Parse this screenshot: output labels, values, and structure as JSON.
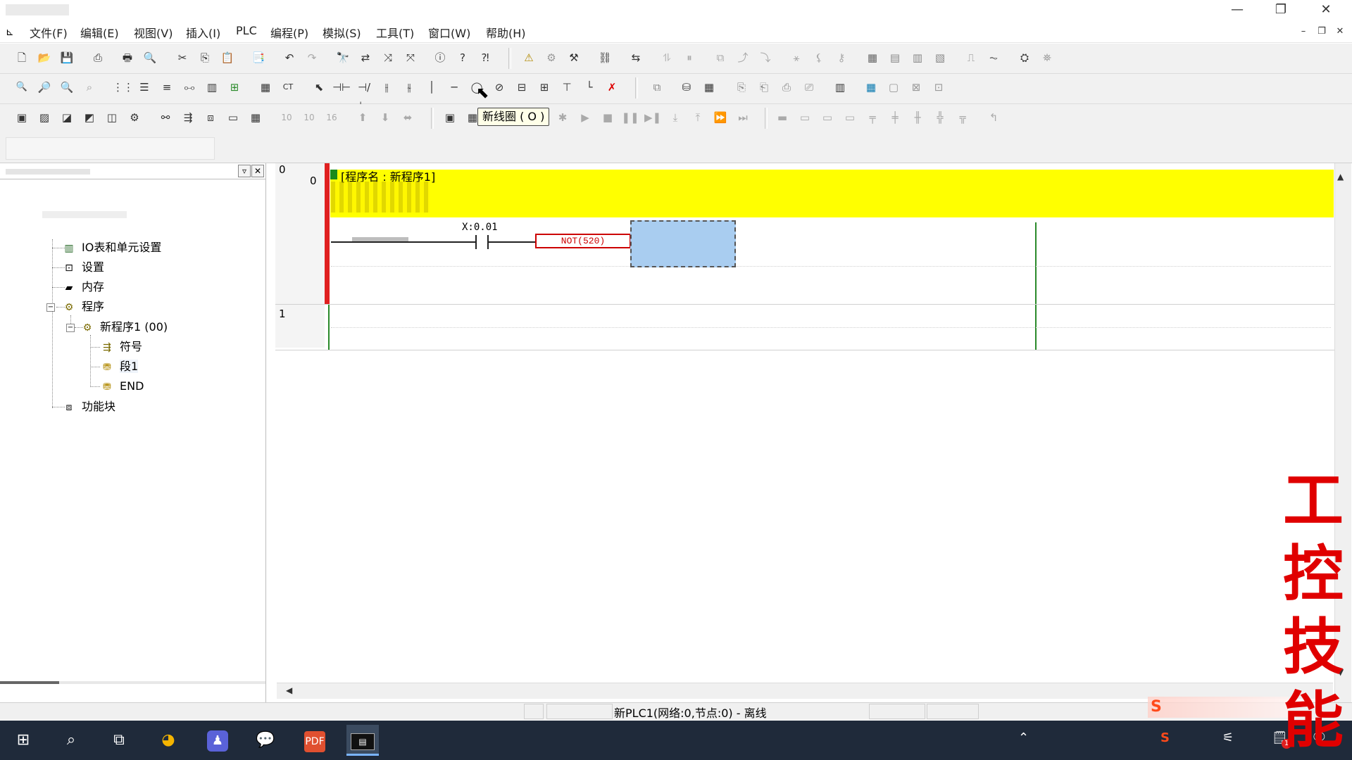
{
  "window": {
    "minimize": "—",
    "restore": "❐",
    "close": "✕"
  },
  "menu": [
    {
      "label": "文件(F)"
    },
    {
      "label": "编辑(E)"
    },
    {
      "label": "视图(V)"
    },
    {
      "label": "插入(I)"
    },
    {
      "label": "PLC"
    },
    {
      "label": "编程(P)"
    },
    {
      "label": "模拟(S)"
    },
    {
      "label": "工具(T)"
    },
    {
      "label": "窗口(W)"
    },
    {
      "label": "帮助(H)"
    }
  ],
  "tooltip": "新线圈 ( O )",
  "tree": {
    "items": [
      {
        "label": "IO表和单元设置"
      },
      {
        "label": "设置"
      },
      {
        "label": "内存"
      },
      {
        "label": "程序"
      },
      {
        "label": "新程序1 (00)"
      },
      {
        "label": "符号"
      },
      {
        "label": "段1"
      },
      {
        "label": "END"
      },
      {
        "label": "功能块"
      }
    ]
  },
  "ladder": {
    "column_header": "0",
    "rungs": [
      {
        "number": "0",
        "title": "[程序名 : 新程序1]"
      },
      {
        "number": "1"
      }
    ],
    "contact_address": "X:0.01",
    "instruction": "NOT(520)"
  },
  "status": {
    "text": "新PLC1(网络:0,节点:0) - 离线"
  },
  "watermark": {
    "chars": [
      "工",
      "控",
      "技",
      "能"
    ],
    "color": "#e00000"
  },
  "colors": {
    "rung_header": "#ffff00",
    "power_rail": "#e02020",
    "cursor_cell": "#a9cdf0",
    "instruction_border": "#cc0000"
  }
}
